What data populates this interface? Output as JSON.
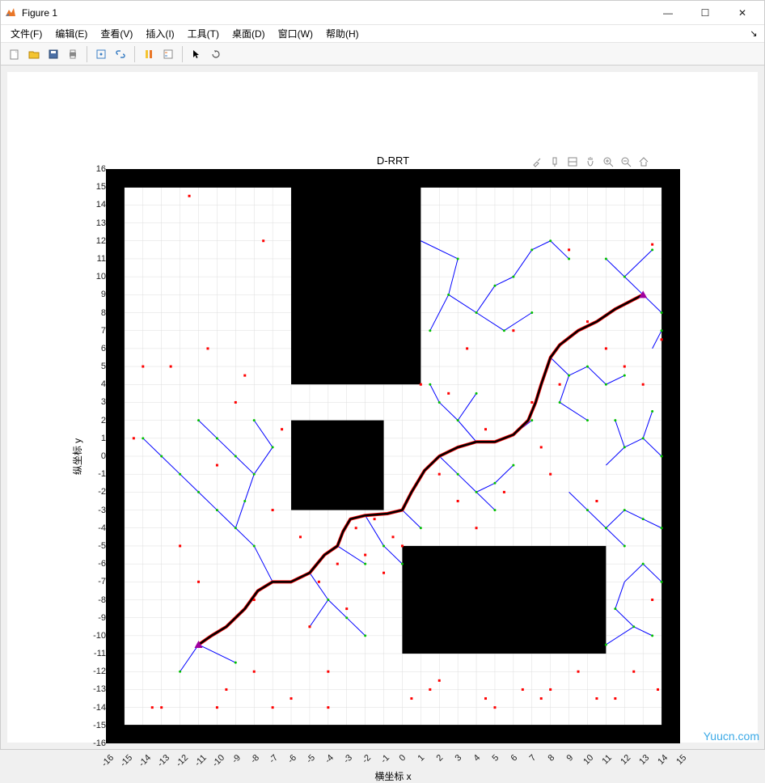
{
  "window": {
    "title": "Figure 1",
    "minimize": "—",
    "maximize": "☐",
    "close": "✕"
  },
  "menu": {
    "file": "文件(F)",
    "edit": "编辑(E)",
    "view": "查看(V)",
    "insert": "插入(I)",
    "tools": "工具(T)",
    "desktop": "桌面(D)",
    "window": "窗口(W)",
    "help": "帮助(H)",
    "overflow": "↘"
  },
  "toolbar": {
    "new": "新建",
    "open": "打开",
    "save": "保存",
    "print": "打印",
    "edit_plot": "编辑绘图",
    "link": "链接",
    "colorbar": "颜色条",
    "legend": "图例",
    "pointer": "指针",
    "rotate": "旋转"
  },
  "axes_toolbar": {
    "brush": "刷选",
    "datatips": "数据提示",
    "reset": "重置",
    "pan": "平移",
    "zoom_in": "放大",
    "zoom_out": "缩小",
    "home": "主页"
  },
  "watermark": "Yuucn.com",
  "chart_data": {
    "type": "scatter",
    "title": "D-RRT",
    "xlabel": "横坐标 x",
    "ylabel": "纵坐标 y",
    "xlim": [
      -16,
      15
    ],
    "ylim": [
      -16,
      16
    ],
    "xticks": [
      -16,
      -15,
      -14,
      -13,
      -12,
      -11,
      -10,
      -9,
      -8,
      -7,
      -6,
      -5,
      -4,
      -3,
      -2,
      -1,
      0,
      1,
      2,
      3,
      4,
      5,
      6,
      7,
      8,
      9,
      10,
      11,
      12,
      13,
      14,
      15
    ],
    "yticks": [
      -16,
      -15,
      -14,
      -13,
      -12,
      -11,
      -10,
      -9,
      -8,
      -7,
      -6,
      -5,
      -4,
      -3,
      -2,
      -1,
      0,
      1,
      2,
      3,
      4,
      5,
      6,
      7,
      8,
      9,
      10,
      11,
      12,
      13,
      14,
      15,
      16
    ],
    "grid": true,
    "obstacles": [
      {
        "type": "outer-wall",
        "x": -16,
        "y": -16,
        "w": 31,
        "h": 32,
        "thickness": 1
      },
      {
        "type": "rect",
        "x": -6,
        "y": 4,
        "w": 7,
        "h": 11
      },
      {
        "type": "rect",
        "x": -6,
        "y": -3,
        "w": 5,
        "h": 5
      },
      {
        "type": "rect",
        "x": 0,
        "y": -11,
        "w": 11,
        "h": 6
      }
    ],
    "start": {
      "x": 13,
      "y": 9
    },
    "goal": {
      "x": -11,
      "y": -10.5
    },
    "path": [
      [
        13,
        9
      ],
      [
        11.5,
        8.2
      ],
      [
        10.5,
        7.5
      ],
      [
        9.5,
        7
      ],
      [
        8.5,
        6.2
      ],
      [
        8,
        5.5
      ],
      [
        7.5,
        4
      ],
      [
        7.2,
        3
      ],
      [
        6.8,
        2
      ],
      [
        6,
        1.2
      ],
      [
        5,
        0.8
      ],
      [
        4,
        0.8
      ],
      [
        3,
        0.5
      ],
      [
        2,
        0
      ],
      [
        1.2,
        -0.8
      ],
      [
        0.5,
        -2
      ],
      [
        0,
        -3
      ],
      [
        -0.8,
        -3.2
      ],
      [
        -2,
        -3.3
      ],
      [
        -2.8,
        -3.5
      ],
      [
        -3.2,
        -4.2
      ],
      [
        -3.5,
        -5
      ],
      [
        -4.2,
        -5.5
      ],
      [
        -5,
        -6.5
      ],
      [
        -6,
        -7
      ],
      [
        -7,
        -7
      ],
      [
        -7.8,
        -7.5
      ],
      [
        -8.5,
        -8.5
      ],
      [
        -9.5,
        -9.5
      ],
      [
        -10.3,
        -10
      ],
      [
        -11,
        -10.5
      ]
    ],
    "tree_edges": [
      [
        [
          1,
          12
        ],
        [
          3,
          11
        ]
      ],
      [
        [
          3,
          11
        ],
        [
          2.5,
          9
        ]
      ],
      [
        [
          2.5,
          9
        ],
        [
          4,
          8
        ]
      ],
      [
        [
          4,
          8
        ],
        [
          5,
          9.5
        ]
      ],
      [
        [
          5,
          9.5
        ],
        [
          6,
          10
        ]
      ],
      [
        [
          2.5,
          9
        ],
        [
          1.5,
          7
        ]
      ],
      [
        [
          4,
          8
        ],
        [
          5.5,
          7
        ]
      ],
      [
        [
          5.5,
          7
        ],
        [
          7,
          8
        ]
      ],
      [
        [
          13,
          9
        ],
        [
          12,
          10
        ]
      ],
      [
        [
          12,
          10
        ],
        [
          11,
          11
        ]
      ],
      [
        [
          12,
          10
        ],
        [
          13.5,
          11.5
        ]
      ],
      [
        [
          13,
          9
        ],
        [
          14,
          8
        ]
      ],
      [
        [
          13,
          9
        ],
        [
          11.5,
          8.2
        ]
      ],
      [
        [
          8,
          5.5
        ],
        [
          9,
          4.5
        ]
      ],
      [
        [
          9,
          4.5
        ],
        [
          10,
          5
        ]
      ],
      [
        [
          10,
          5
        ],
        [
          11,
          4
        ]
      ],
      [
        [
          11,
          4
        ],
        [
          12,
          4.5
        ]
      ],
      [
        [
          9,
          4.5
        ],
        [
          8.5,
          3
        ]
      ],
      [
        [
          8.5,
          3
        ],
        [
          10,
          2
        ]
      ],
      [
        [
          6,
          1.2
        ],
        [
          7,
          2
        ]
      ],
      [
        [
          4,
          0.8
        ],
        [
          3,
          2
        ]
      ],
      [
        [
          3,
          2
        ],
        [
          2,
          3
        ]
      ],
      [
        [
          2,
          3
        ],
        [
          1.5,
          4
        ]
      ],
      [
        [
          3,
          2
        ],
        [
          4,
          3.5
        ]
      ],
      [
        [
          2,
          0
        ],
        [
          3,
          -1
        ]
      ],
      [
        [
          3,
          -1
        ],
        [
          4,
          -2
        ]
      ],
      [
        [
          4,
          -2
        ],
        [
          5,
          -1.5
        ]
      ],
      [
        [
          5,
          -1.5
        ],
        [
          6,
          -0.5
        ]
      ],
      [
        [
          4,
          -2
        ],
        [
          5,
          -3
        ]
      ],
      [
        [
          0,
          -3
        ],
        [
          1,
          -4
        ]
      ],
      [
        [
          -2,
          -3.3
        ],
        [
          -1,
          -5
        ]
      ],
      [
        [
          -1,
          -5
        ],
        [
          0,
          -6
        ]
      ],
      [
        [
          -3.5,
          -5
        ],
        [
          -2,
          -6
        ]
      ],
      [
        [
          -5,
          -6.5
        ],
        [
          -4,
          -8
        ]
      ],
      [
        [
          -4,
          -8
        ],
        [
          -3,
          -9
        ]
      ],
      [
        [
          -3,
          -9
        ],
        [
          -2,
          -10
        ]
      ],
      [
        [
          -4,
          -8
        ],
        [
          -5,
          -9.5
        ]
      ],
      [
        [
          -7,
          -7
        ],
        [
          -8,
          -5
        ]
      ],
      [
        [
          -8,
          -5
        ],
        [
          -9,
          -4
        ]
      ],
      [
        [
          -9,
          -4
        ],
        [
          -10,
          -3
        ]
      ],
      [
        [
          -10,
          -3
        ],
        [
          -11,
          -2
        ]
      ],
      [
        [
          -9,
          -4
        ],
        [
          -8.5,
          -2.5
        ]
      ],
      [
        [
          -8.5,
          -2.5
        ],
        [
          -8,
          -1
        ]
      ],
      [
        [
          -8,
          -1
        ],
        [
          -9,
          0
        ]
      ],
      [
        [
          -9,
          0
        ],
        [
          -10,
          1
        ]
      ],
      [
        [
          -10,
          1
        ],
        [
          -11,
          2
        ]
      ],
      [
        [
          -8,
          -1
        ],
        [
          -7,
          0.5
        ]
      ],
      [
        [
          -7,
          0.5
        ],
        [
          -8,
          2
        ]
      ],
      [
        [
          -11,
          -2
        ],
        [
          -12,
          -1
        ]
      ],
      [
        [
          -12,
          -1
        ],
        [
          -13,
          0
        ]
      ],
      [
        [
          -13,
          0
        ],
        [
          -14,
          1
        ]
      ],
      [
        [
          -11,
          -10.5
        ],
        [
          -12,
          -12
        ]
      ],
      [
        [
          -11,
          -10.5
        ],
        [
          -9,
          -11.5
        ]
      ],
      [
        [
          11,
          -0.5
        ],
        [
          12,
          0.5
        ]
      ],
      [
        [
          12,
          0.5
        ],
        [
          13,
          1
        ]
      ],
      [
        [
          13,
          1
        ],
        [
          14,
          0
        ]
      ],
      [
        [
          12,
          0.5
        ],
        [
          11.5,
          2
        ]
      ],
      [
        [
          13,
          1
        ],
        [
          13.5,
          2.5
        ]
      ],
      [
        [
          9,
          -2
        ],
        [
          10,
          -3
        ]
      ],
      [
        [
          10,
          -3
        ],
        [
          11,
          -4
        ]
      ],
      [
        [
          11,
          -4
        ],
        [
          12,
          -3
        ]
      ],
      [
        [
          12,
          -3
        ],
        [
          13,
          -3.5
        ]
      ],
      [
        [
          13,
          -3.5
        ],
        [
          14,
          -4
        ]
      ],
      [
        [
          11,
          -4
        ],
        [
          12,
          -5
        ]
      ],
      [
        [
          12,
          -7
        ],
        [
          13,
          -6
        ]
      ],
      [
        [
          13,
          -6
        ],
        [
          14,
          -7
        ]
      ],
      [
        [
          12,
          -7
        ],
        [
          11.5,
          -8.5
        ]
      ],
      [
        [
          11.5,
          -8.5
        ],
        [
          12.5,
          -9.5
        ]
      ],
      [
        [
          12.5,
          -9.5
        ],
        [
          13.5,
          -10
        ]
      ],
      [
        [
          12.5,
          -9.5
        ],
        [
          11,
          -10.5
        ]
      ],
      [
        [
          13.5,
          6
        ],
        [
          14,
          7
        ]
      ],
      [
        [
          6,
          10
        ],
        [
          7,
          11.5
        ]
      ],
      [
        [
          7,
          11.5
        ],
        [
          8,
          12
        ]
      ],
      [
        [
          8,
          12
        ],
        [
          9,
          11
        ]
      ]
    ],
    "samples": [
      [
        -14.5,
        1
      ],
      [
        -13,
        -14
      ],
      [
        -12.5,
        5
      ],
      [
        -12,
        -5
      ],
      [
        -11.5,
        14.5
      ],
      [
        -11,
        -7
      ],
      [
        -10.5,
        6
      ],
      [
        -10,
        -0.5
      ],
      [
        -9.5,
        -13
      ],
      [
        -9,
        3
      ],
      [
        -8.5,
        4.5
      ],
      [
        -8,
        -8
      ],
      [
        -7.5,
        12
      ],
      [
        -7,
        -3
      ],
      [
        -6.5,
        1.5
      ],
      [
        -6,
        -13.5
      ],
      [
        -5.5,
        -4.5
      ],
      [
        -5,
        -9.5
      ],
      [
        -4.5,
        -7
      ],
      [
        -4,
        -12
      ],
      [
        -3.5,
        -6
      ],
      [
        -3,
        -8.5
      ],
      [
        -2.5,
        -4
      ],
      [
        -2,
        -5.5
      ],
      [
        -1.5,
        -3.5
      ],
      [
        -1,
        -6.5
      ],
      [
        -0.5,
        -4.5
      ],
      [
        0,
        -5
      ],
      [
        0.5,
        -13.5
      ],
      [
        1,
        4
      ],
      [
        1.5,
        -13
      ],
      [
        2,
        -1
      ],
      [
        2.5,
        3.5
      ],
      [
        3,
        -2.5
      ],
      [
        3.5,
        6
      ],
      [
        4,
        -4
      ],
      [
        4.5,
        1.5
      ],
      [
        5,
        -14
      ],
      [
        5.5,
        -2
      ],
      [
        6,
        7
      ],
      [
        6.5,
        -13
      ],
      [
        7,
        3
      ],
      [
        7.5,
        0.5
      ],
      [
        8,
        -1
      ],
      [
        8.5,
        4
      ],
      [
        9,
        11.5
      ],
      [
        9.5,
        -12
      ],
      [
        10,
        7.5
      ],
      [
        10.5,
        -2.5
      ],
      [
        11,
        6
      ],
      [
        11.5,
        -13.5
      ],
      [
        12,
        5
      ],
      [
        12.5,
        -12
      ],
      [
        13,
        4
      ],
      [
        13.5,
        -8
      ],
      [
        13.8,
        -13
      ],
      [
        14,
        6.5
      ],
      [
        13.5,
        11.8
      ],
      [
        -14,
        5
      ],
      [
        -13.5,
        -14
      ],
      [
        -8,
        -12
      ],
      [
        -7,
        -14
      ],
      [
        2,
        -12.5
      ],
      [
        4.5,
        -13.5
      ],
      [
        8,
        -13
      ],
      [
        10.5,
        -13.5
      ],
      [
        -10,
        -14
      ],
      [
        -4,
        -14
      ],
      [
        7.5,
        -13.5
      ]
    ]
  }
}
